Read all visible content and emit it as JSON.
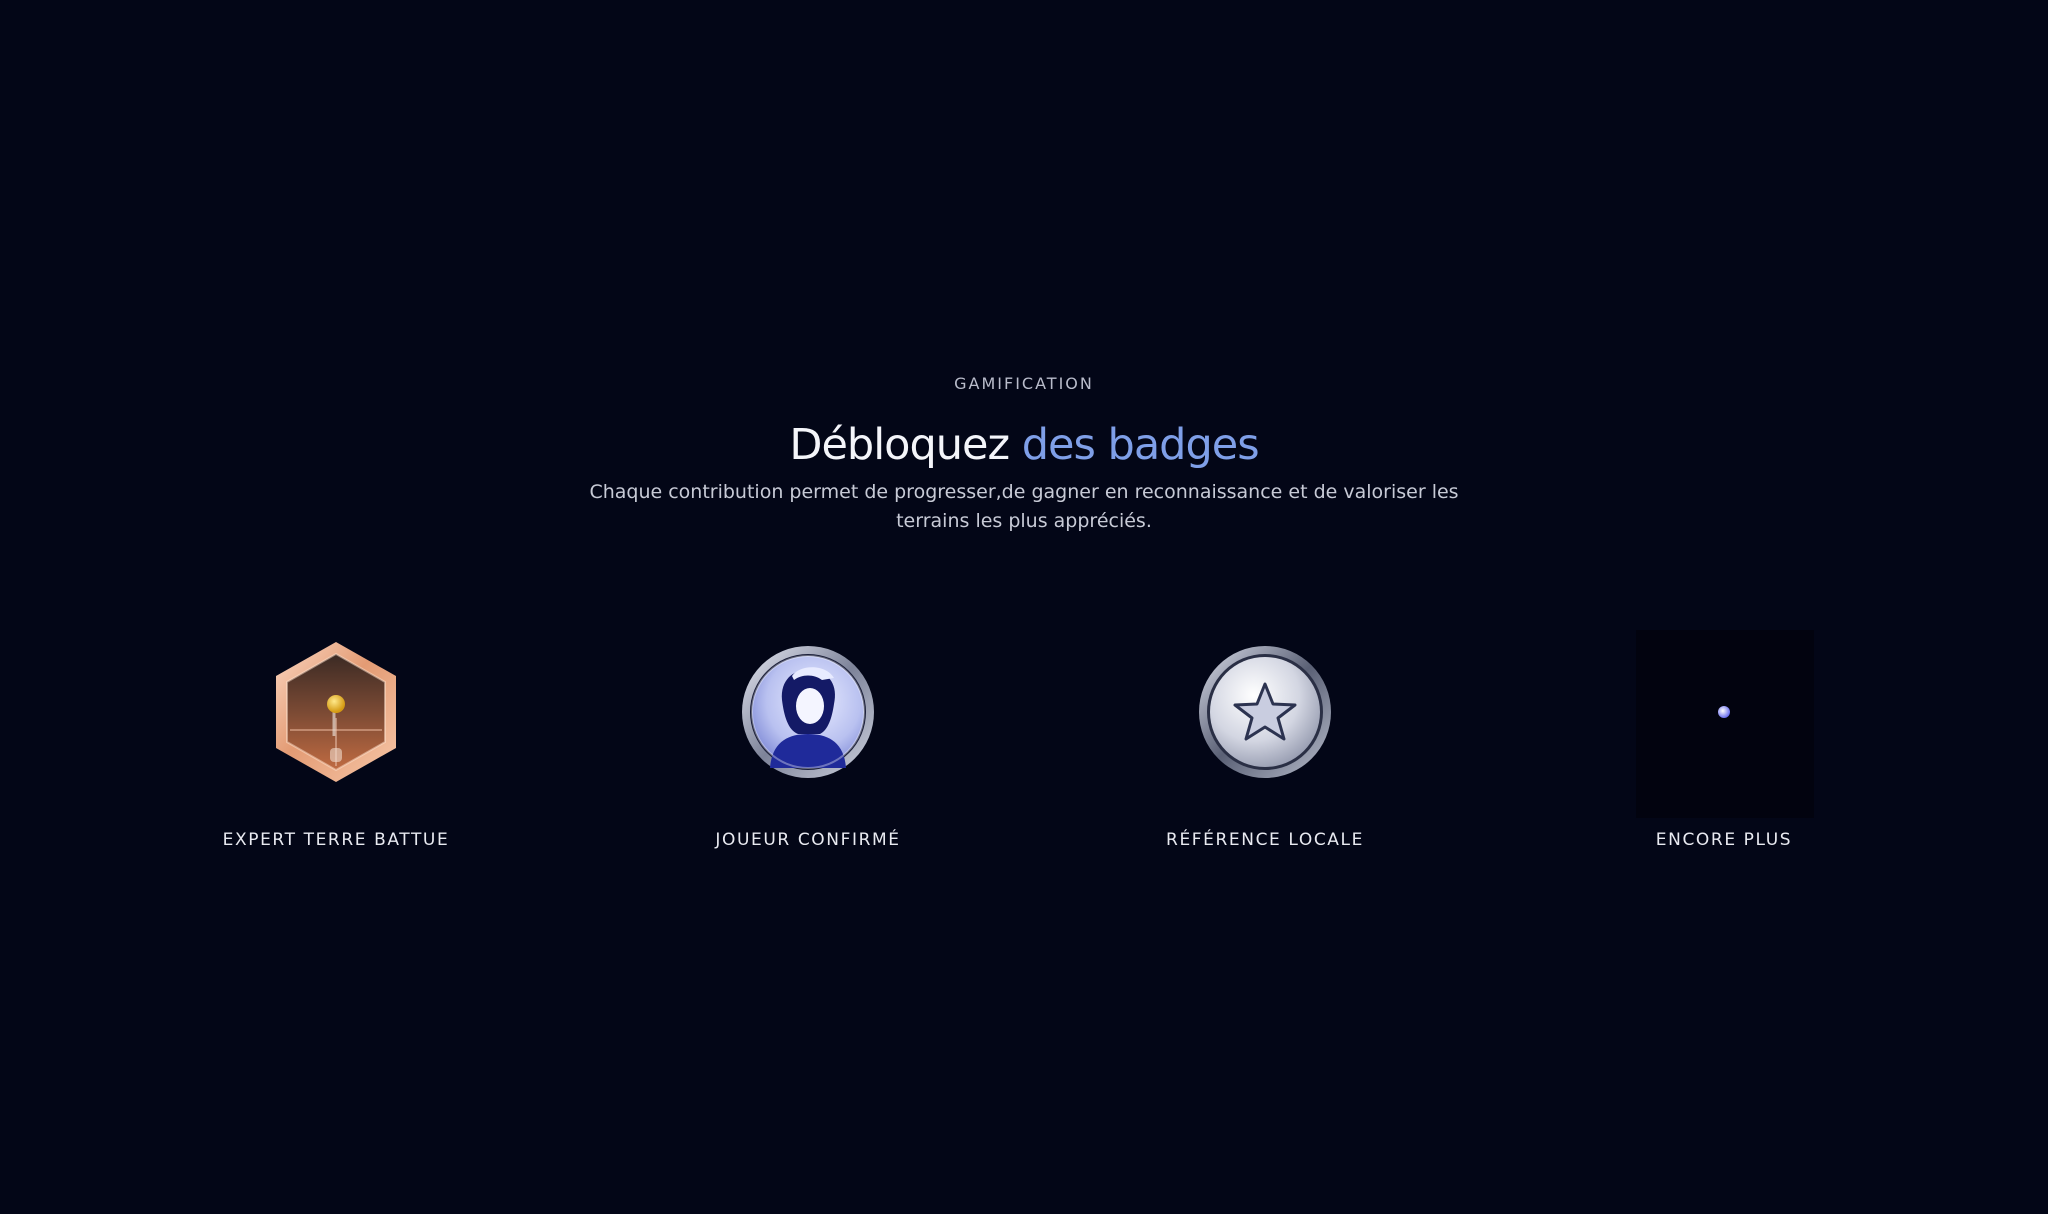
{
  "section": {
    "eyebrow": "GAMIFICATION",
    "title_part1": "Débloquez ",
    "title_part2": "des badges",
    "subtitle": "Chaque contribution permet de progresser,de gagner en reconnaissance et de valoriser les terrains les plus appréciés."
  },
  "badges": [
    {
      "label": "EXPERT TERRE BATTUE",
      "icon": "clay-court-hexagon-badge-icon"
    },
    {
      "label": "JOUEUR CONFIRMÉ",
      "icon": "player-portrait-badge-icon"
    },
    {
      "label": "RÉFÉRENCE LOCALE",
      "icon": "star-badge-icon"
    },
    {
      "label": "ENCORE PLUS",
      "icon": "more-badges-icon"
    }
  ],
  "colors": {
    "background": "#030617",
    "accent": "#7f9fe8",
    "bronze": "#e8a37d",
    "silver": "#c8ccd8"
  }
}
